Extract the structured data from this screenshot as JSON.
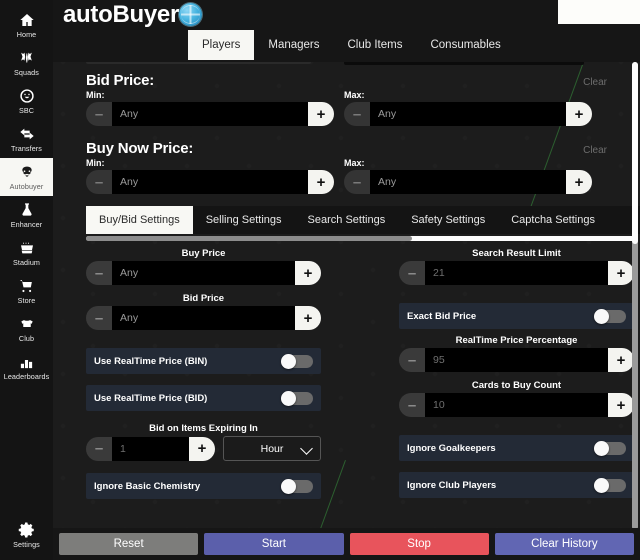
{
  "sidebar": {
    "items": [
      {
        "label": "Home",
        "icon": "home-icon",
        "active": false
      },
      {
        "label": "Squads",
        "icon": "squads-icon",
        "active": false
      },
      {
        "label": "SBC",
        "icon": "sbc-icon",
        "active": false
      },
      {
        "label": "Transfers",
        "icon": "transfers-icon",
        "active": false
      },
      {
        "label": "Autobuyer",
        "icon": "autobuyer-icon",
        "active": true
      },
      {
        "label": "Enhancer",
        "icon": "enhancer-icon",
        "active": false
      },
      {
        "label": "Stadium",
        "icon": "stadium-icon",
        "active": false
      },
      {
        "label": "Store",
        "icon": "store-icon",
        "active": false
      },
      {
        "label": "Club",
        "icon": "club-icon",
        "active": false
      },
      {
        "label": "Leaderboards",
        "icon": "leaderboards-icon",
        "active": false
      }
    ],
    "settings": {
      "label": "Settings",
      "icon": "gear-icon"
    }
  },
  "header": {
    "brand": "autoBuyer",
    "globe_icon": "globe-icon",
    "tabs": [
      {
        "label": "Players",
        "active": true
      },
      {
        "label": "Managers",
        "active": false
      },
      {
        "label": "Club Items",
        "active": false
      },
      {
        "label": "Consumables",
        "active": false
      }
    ]
  },
  "bid_price": {
    "title": "Bid Price:",
    "clear_label": "Clear",
    "min_label": "Min:",
    "max_label": "Max:",
    "min_value": "Any",
    "max_value": "Any",
    "minus_label": "–",
    "plus_label": "+"
  },
  "buy_now_price": {
    "title": "Buy Now Price:",
    "clear_label": "Clear",
    "min_label": "Min:",
    "max_label": "Max:",
    "min_value": "Any",
    "max_value": "Any"
  },
  "settings_tabs": [
    {
      "label": "Buy/Bid Settings",
      "active": true
    },
    {
      "label": "Selling Settings",
      "active": false
    },
    {
      "label": "Search Settings",
      "active": false
    },
    {
      "label": "Safety Settings",
      "active": false
    },
    {
      "label": "Captcha Settings",
      "active": false
    }
  ],
  "buy_bid_settings": {
    "left": {
      "buy_price": {
        "label": "Buy Price",
        "value": "Any"
      },
      "bid_price": {
        "label": "Bid Price",
        "value": "Any"
      },
      "use_realtime_bin": {
        "label": "Use RealTime Price (BIN)",
        "on": false
      },
      "use_realtime_bid": {
        "label": "Use RealTime Price (BID)",
        "on": false
      },
      "bid_expiring": {
        "label": "Bid on Items Expiring In",
        "value": "1",
        "unit": "Hour"
      },
      "ignore_basic_chemistry": {
        "label": "Ignore Basic Chemistry",
        "on": false
      }
    },
    "right": {
      "search_result_limit": {
        "label": "Search Result Limit",
        "value": "21"
      },
      "exact_bid_price": {
        "label": "Exact Bid Price",
        "on": false
      },
      "realtime_price_percentage": {
        "label": "RealTime Price Percentage",
        "value": "95"
      },
      "cards_to_buy_count": {
        "label": "Cards to Buy Count",
        "value": "10"
      },
      "ignore_goalkeepers": {
        "label": "Ignore Goalkeepers",
        "on": false
      },
      "ignore_club_players": {
        "label": "Ignore Club Players",
        "on": false
      }
    }
  },
  "actions": [
    {
      "label": "Reset",
      "color": "#7d7d7b"
    },
    {
      "label": "Start",
      "color": "#5b5fab"
    },
    {
      "label": "Stop",
      "color": "#e8545c"
    },
    {
      "label": "Clear History",
      "color": "#6166b3"
    }
  ],
  "colors": {
    "accent_white": "#f7f7f3",
    "toggle_row_bg": "#232a36",
    "green_line": "#2f6b33"
  }
}
